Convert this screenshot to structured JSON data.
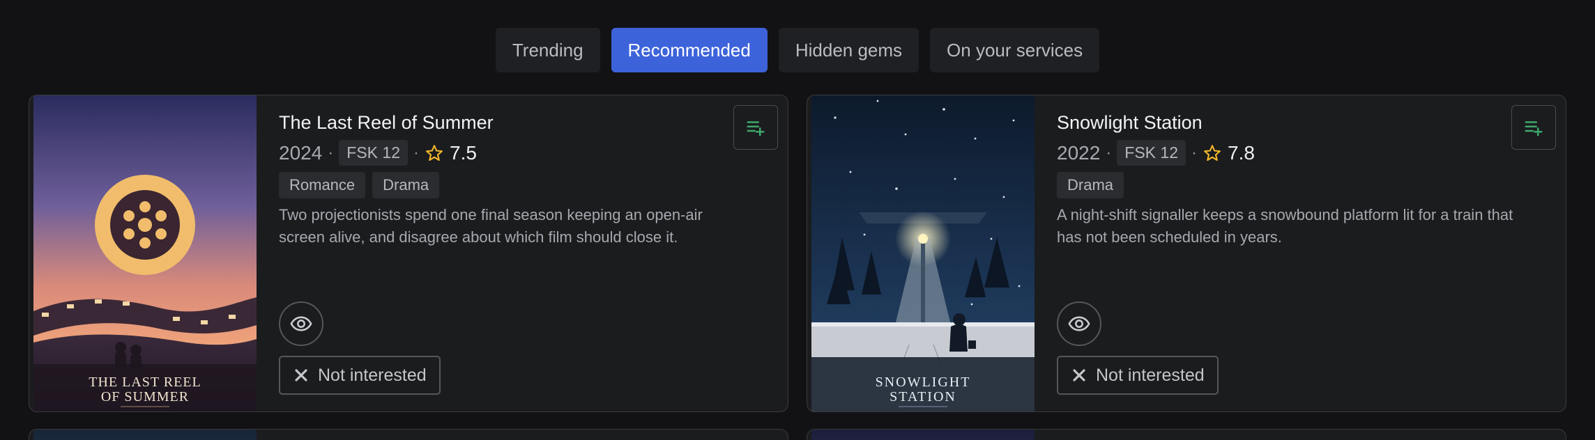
{
  "tabs": [
    {
      "label": "Trending",
      "active": false
    },
    {
      "label": "Recommended",
      "active": true
    },
    {
      "label": "Hidden gems",
      "active": false
    },
    {
      "label": "On your services",
      "active": false
    }
  ],
  "cards": [
    {
      "title": "The Last Reel of Summer",
      "year": "2024",
      "age_rating": "FSK 12",
      "rating": "7.5",
      "genres": [
        "Romance",
        "Drama"
      ],
      "description": "Two projectionists spend one final season keeping an open-air screen alive, and disagree about which film should close it.",
      "poster_title_line1": "THE LAST REEL",
      "poster_title_line2": "OF SUMMER",
      "not_interested_label": "Not interested"
    },
    {
      "title": "Snowlight Station",
      "year": "2022",
      "age_rating": "FSK 12",
      "rating": "7.8",
      "genres": [
        "Drama"
      ],
      "description": "A night-shift signaller keeps a snowbound platform lit for a train that has not been scheduled in years.",
      "poster_title_line1": "SNOWLIGHT",
      "poster_title_line2": "STATION",
      "not_interested_label": "Not interested"
    }
  ],
  "colors": {
    "accent": "#3d63db",
    "star": "#f5b82a",
    "watchlist_icon": "#3ea86b"
  },
  "icons": {
    "watchlist": "playlist-add-icon",
    "seen": "eye-icon",
    "dismiss": "close-icon",
    "rating": "star-outline-icon"
  }
}
